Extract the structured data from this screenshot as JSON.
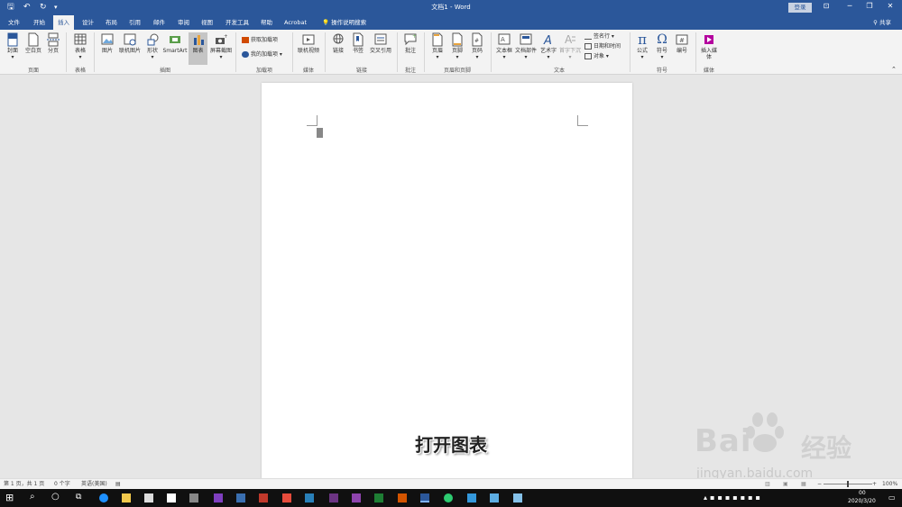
{
  "title_bar": {
    "doc_title": "文档1 - Word",
    "login_label": "登录",
    "minimize": "─",
    "restore": "❐",
    "close": "✕",
    "ribbon_display": "⊡"
  },
  "tabs": [
    "文件",
    "开始",
    "插入",
    "设计",
    "布局",
    "引用",
    "邮件",
    "审阅",
    "视图",
    "开发工具",
    "帮助",
    "Acrobat"
  ],
  "active_tab": "插入",
  "search_label": "操作说明搜索",
  "share_label": "共享",
  "ribbon": {
    "pages_group": {
      "label": "页面",
      "cover": "封面",
      "blank": "空白页",
      "break": "分页"
    },
    "tables_group": {
      "label": "表格",
      "table": "表格"
    },
    "illustrations_group": {
      "label": "插图",
      "picture": "图片",
      "online_picture": "联机图片",
      "shapes": "形状",
      "smartart": "SmartArt",
      "chart": "图表",
      "screenshot": "屏幕截图"
    },
    "addins_group": {
      "label": "加载项",
      "get": "获取加载项",
      "my": "我的加载项"
    },
    "media_group": {
      "label": "媒体",
      "online_video": "联机视频"
    },
    "links_group": {
      "label": "链接",
      "link": "链接",
      "bookmark": "书签",
      "cross_ref": "交叉引用"
    },
    "comments_group": {
      "label": "批注",
      "comment": "批注"
    },
    "header_footer_group": {
      "label": "页眉和页脚",
      "header": "页眉",
      "footer": "页脚",
      "page_number": "页码"
    },
    "text_group": {
      "label": "文本",
      "textbox": "文本框",
      "quick_parts": "文档部件",
      "wordart": "艺术字",
      "dropcap": "首字下沉",
      "signature": "签名行",
      "datetime": "日期和时间",
      "object": "对象"
    },
    "symbols_group": {
      "label": "符号",
      "equation": "公式",
      "symbol": "符号",
      "number": "编号"
    },
    "media2_group": {
      "label": "媒体",
      "insert_media": "插入媒体"
    }
  },
  "caption": "打开图表",
  "status": {
    "page": "第 1 页，共 1 页",
    "words": "0 个字",
    "language": "英语(美国)",
    "zoom": "100%"
  },
  "taskbar": {
    "time": "00",
    "date": "2020/3/20"
  },
  "watermark": {
    "line1": "Bai",
    "line2": "经验",
    "url": "jingyan.baidu.com"
  },
  "colors": {
    "accent": "#2b579a",
    "ribbon_bg": "#f3f3f3",
    "canvas_bg": "#e6e6e6"
  }
}
